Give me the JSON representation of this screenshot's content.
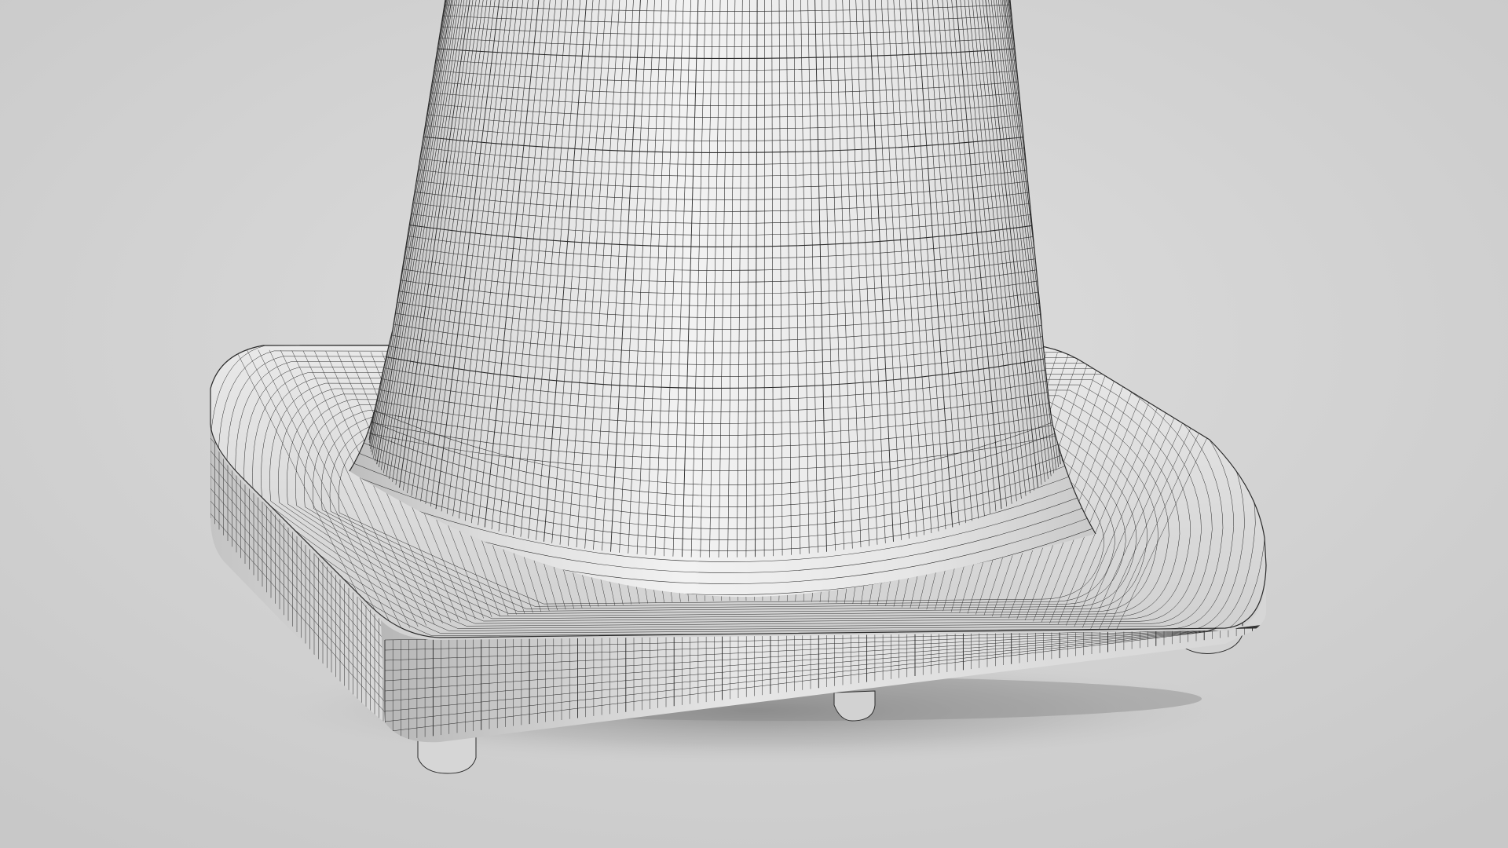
{
  "scene": {
    "subject": "traffic-cone-wireframe",
    "colors": {
      "background_light": "#dcdcdc",
      "background_dark": "#c6c6c6",
      "surface_light": "#f0f0f0",
      "surface_mid": "#d8d8d8",
      "surface_dark": "#a9a9a9",
      "wire": "#2a2a2a",
      "shadow": "#8e8e8e"
    }
  }
}
